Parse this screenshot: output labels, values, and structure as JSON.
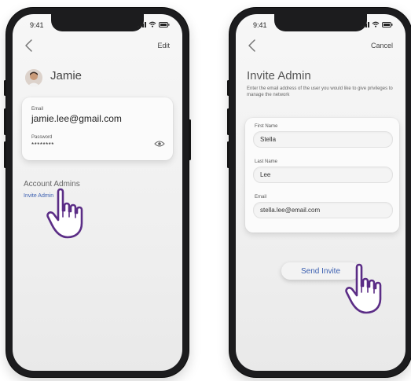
{
  "left_screen": {
    "status": {
      "time": "9:41"
    },
    "nav": {
      "edit_label": "Edit"
    },
    "profile": {
      "name": "Jamie"
    },
    "account_card": {
      "email_label": "Email",
      "email_value": "jamie.lee@gmail.com",
      "password_label": "Password",
      "password_value": "********"
    },
    "admins": {
      "title": "Account Admins",
      "invite_link": "Invite Admin"
    }
  },
  "right_screen": {
    "status": {
      "time": "9:41"
    },
    "nav": {
      "cancel_label": "Cancel"
    },
    "title": "Invite Admin",
    "description": "Enter the email address of the user you would like to give privileges to manage the network",
    "form": {
      "first_name_label": "First Name",
      "first_name_value": "Stella",
      "last_name_label": "Last Name",
      "last_name_value": "Lee",
      "email_label": "Email",
      "email_value": "stella.lee@email.com"
    },
    "send_button": "Send Invite"
  },
  "colors": {
    "link_blue": "#3b5fb0",
    "hand_outline": "#5b2d86",
    "phone_frame": "#1c1c1e"
  },
  "icons": [
    "back-chevron-icon",
    "signal-icon",
    "wifi-icon",
    "battery-icon",
    "eye-icon",
    "pointing-hand-icon"
  ]
}
